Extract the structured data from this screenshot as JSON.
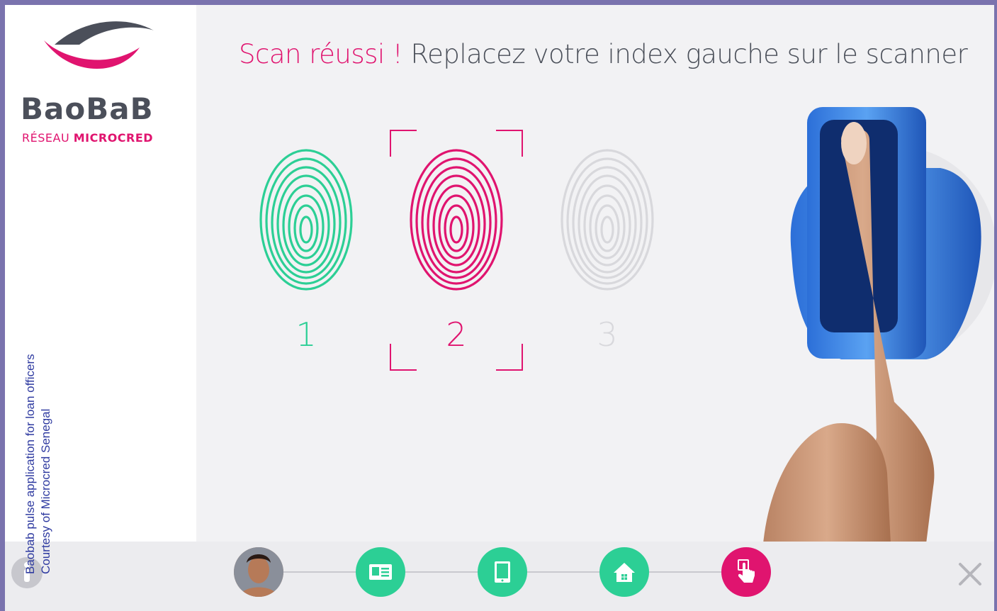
{
  "brand": {
    "name": "BaoBaB",
    "network_prefix": "RÉSEAU",
    "network_name": "MICROCRED",
    "colors": {
      "pink": "#e0146f",
      "gray": "#4b4f5a"
    }
  },
  "caption": {
    "line1": "Baobab pulse application for loan officers",
    "line2": "Courtesy of Microcred Senegal"
  },
  "heading": {
    "success": "Scan réussi !",
    "instruction": "Replacez votre index gauche sur le scanner"
  },
  "scans": [
    {
      "label": "1",
      "state": "done",
      "color": "#2ccf95"
    },
    {
      "label": "2",
      "state": "active",
      "color": "#e0146f"
    },
    {
      "label": "3",
      "state": "pending",
      "color": "#d8d8dc"
    }
  ],
  "steps": [
    {
      "name": "photo",
      "icon": "client-avatar",
      "color": "#d9a98a"
    },
    {
      "name": "id-card",
      "icon": "id-card-icon",
      "color": "#2ccf95"
    },
    {
      "name": "device",
      "icon": "tablet-icon",
      "color": "#2ccf95"
    },
    {
      "name": "home",
      "icon": "home-icon",
      "color": "#2ccf95"
    },
    {
      "name": "fingerprint",
      "icon": "touch-icon",
      "color": "#e0146f"
    }
  ],
  "controls": {
    "close_icon": "close-icon",
    "info_icon": "info-icon"
  }
}
